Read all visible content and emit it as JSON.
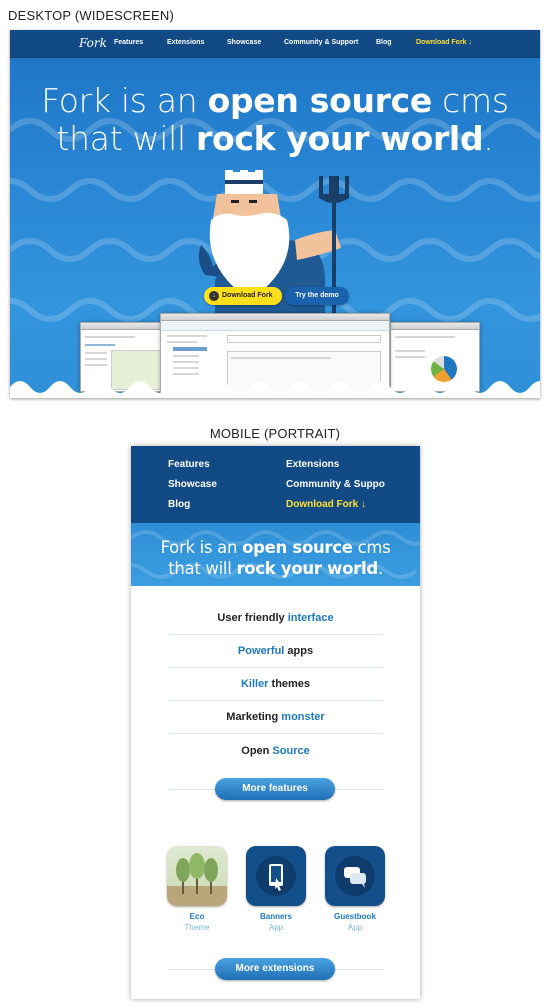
{
  "captions": {
    "desktop": "DESKTOP (WIDESCREEN)",
    "mobile": "MOBILE (PORTRAIT)"
  },
  "desktop": {
    "logo": "Fork",
    "nav": [
      "Features",
      "Extensions",
      "Showcase",
      "Community & Support",
      "Blog",
      "Download Fork ↓"
    ],
    "headline_pre": "Fork is an ",
    "headline_bold1": "open source",
    "headline_mid": " cms",
    "headline_line2_pre": "that will ",
    "headline_bold2": "rock your world",
    "headline_end": ".",
    "download_btn": "Download Fork",
    "download_icon": "↓",
    "try_btn": "Try the demo"
  },
  "mobile": {
    "nav": {
      "features": "Features",
      "extensions": "Extensions",
      "showcase": "Showcase",
      "community": "Community & Suppo",
      "blog": "Blog",
      "download": "Download Fork ↓"
    },
    "headline_pre": "Fork is an ",
    "headline_bold1": "open source",
    "headline_mid": " cms",
    "headline_line2_pre": "that will ",
    "headline_bold2": "rock your world",
    "headline_end": ".",
    "features": [
      {
        "a": "User friendly ",
        "b": "interface",
        "hl": "b"
      },
      {
        "a": "Powerful",
        "b": " apps",
        "hl": "a"
      },
      {
        "a": "Killer",
        "b": " themes",
        "hl": "a"
      },
      {
        "a": "Marketing ",
        "b": "monster",
        "hl": "b"
      },
      {
        "a": "Open ",
        "b": "Source",
        "hl": "b"
      }
    ],
    "more_features": "More features",
    "apps": [
      {
        "name": "Eco",
        "type": "Theme"
      },
      {
        "name": "Banners",
        "type": "App"
      },
      {
        "name": "Guestbook",
        "type": "App"
      }
    ],
    "more_extensions": "More extensions"
  },
  "colors": {
    "nav": "#124a86",
    "accent": "#1e78c2",
    "download": "#ffe033",
    "hero": "#2a88d6"
  }
}
